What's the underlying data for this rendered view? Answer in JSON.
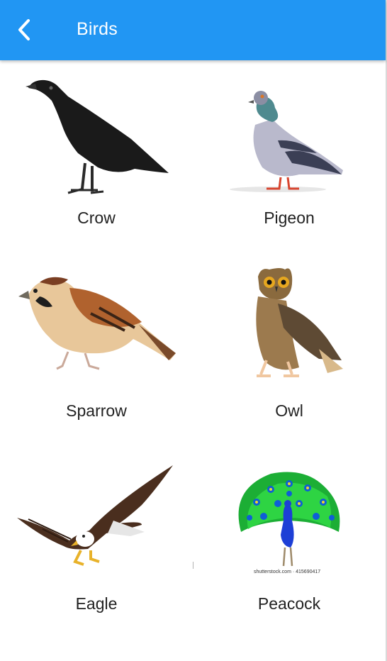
{
  "appbar": {
    "title": "Birds",
    "back_icon": "chevron-left-icon",
    "color": "#2196F3"
  },
  "birds": [
    {
      "name": "Crow",
      "icon": "crow-image"
    },
    {
      "name": "Pigeon",
      "icon": "pigeon-image"
    },
    {
      "name": "Sparrow",
      "icon": "sparrow-image"
    },
    {
      "name": "Owl",
      "icon": "owl-image"
    },
    {
      "name": "Eagle",
      "icon": "eagle-image"
    },
    {
      "name": "Peacock",
      "icon": "peacock-image"
    }
  ],
  "peacock_watermark": "shutterstock.com · 415690417"
}
